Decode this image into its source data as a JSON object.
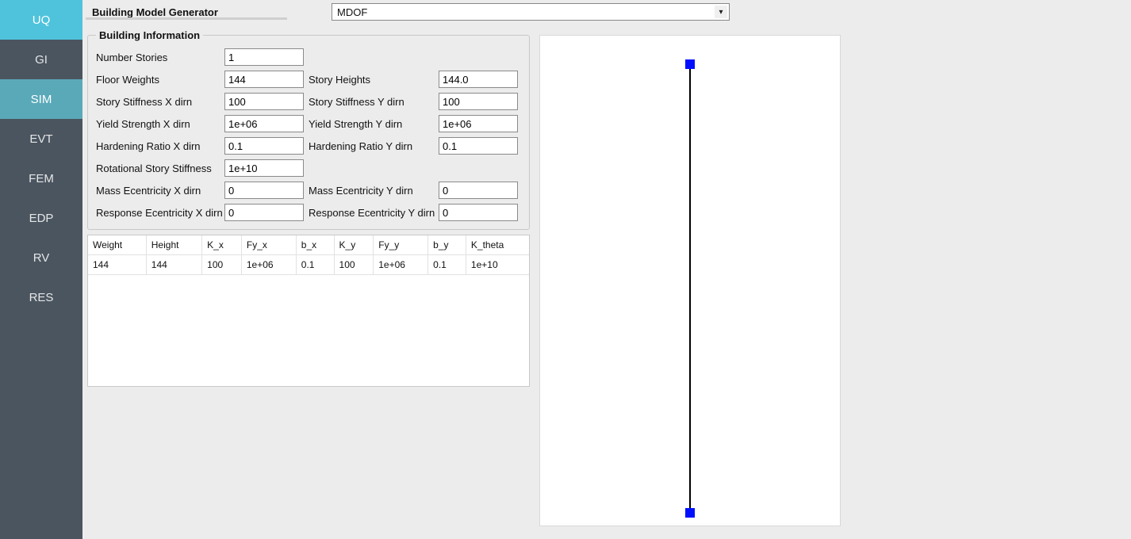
{
  "sidebar": {
    "items": [
      {
        "label": "UQ"
      },
      {
        "label": "GI"
      },
      {
        "label": "SIM"
      },
      {
        "label": "EVT"
      },
      {
        "label": "FEM"
      },
      {
        "label": "EDP"
      },
      {
        "label": "RV"
      },
      {
        "label": "RES"
      }
    ],
    "active": "UQ",
    "current": "SIM"
  },
  "header": {
    "title": "Building Model Generator",
    "generator_selected": "MDOF"
  },
  "building_info": {
    "group_title": "Building Information",
    "labels": {
      "num_stories": "Number Stories",
      "floor_weights": "Floor Weights",
      "story_heights": "Story Heights",
      "stiff_x": "Story Stiffness X dirn",
      "stiff_y": "Story Stiffness Y dirn",
      "yield_x": "Yield Strength X dirn",
      "yield_y": "Yield Strength Y dirn",
      "hard_x": "Hardening Ratio X dirn",
      "hard_y": "Hardening Ratio Y dirn",
      "rot_stiff": "Rotational Story Stiffness",
      "mass_ecc_x": "Mass Ecentricity X dirn",
      "mass_ecc_y": "Mass Ecentricity Y dirn",
      "resp_ecc_x": "Response Ecentricity X dirn",
      "resp_ecc_y": "Response Ecentricity Y dirn"
    },
    "values": {
      "num_stories": "1",
      "floor_weights": "144",
      "story_heights": "144.0",
      "stiff_x": "100",
      "stiff_y": "100",
      "yield_x": "1e+06",
      "yield_y": "1e+06",
      "hard_x": "0.1",
      "hard_y": "0.1",
      "rot_stiff": "1e+10",
      "mass_ecc_x": "0",
      "mass_ecc_y": "0",
      "resp_ecc_x": "0",
      "resp_ecc_y": "0"
    }
  },
  "table": {
    "headers": [
      "Weight",
      "Height",
      "K_x",
      "Fy_x",
      "b_x",
      "K_y",
      "Fy_y",
      "b_y",
      "K_theta"
    ],
    "rows": [
      [
        "144",
        "144",
        "100",
        "1e+06",
        "0.1",
        "100",
        "1e+06",
        "0.1",
        "1e+10"
      ]
    ]
  }
}
